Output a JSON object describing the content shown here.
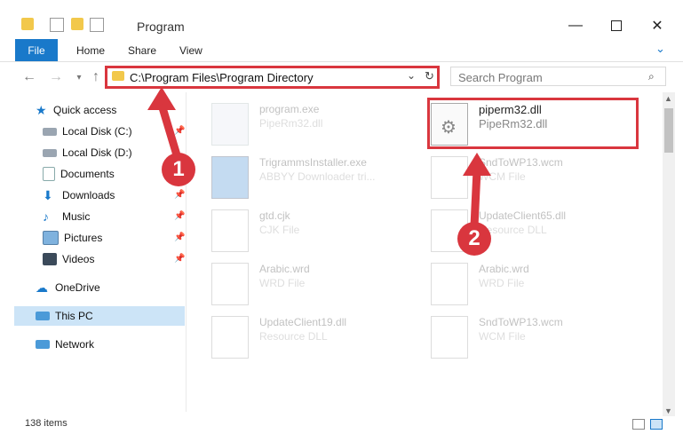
{
  "window": {
    "title": "Program",
    "min_icon": "minimize-icon",
    "max_icon": "maximize-icon",
    "close_icon": "close-icon"
  },
  "ribbon": {
    "tabs": [
      "File",
      "Home",
      "Share",
      "View"
    ]
  },
  "address": {
    "path": "C:\\Program Files\\Program Directory"
  },
  "search": {
    "placeholder": "Search Program"
  },
  "nav": {
    "items": [
      {
        "label": "Quick access"
      },
      {
        "label": "Local Disk (C:)"
      },
      {
        "label": "Local Disk (D:)"
      },
      {
        "label": "Documents"
      },
      {
        "label": "Downloads"
      },
      {
        "label": "Music"
      },
      {
        "label": "Pictures"
      },
      {
        "label": "Videos"
      },
      {
        "label": "OneDrive"
      },
      {
        "label": "This PC"
      },
      {
        "label": "Network"
      }
    ]
  },
  "files": [
    {
      "name": "program.exe",
      "type": "PipeRm32.dll"
    },
    {
      "name": "piperm32.dll",
      "type": "PipeRm32.dll"
    },
    {
      "name": "TrigrammsInstaller.exe",
      "type": "ABBYY Downloader tri..."
    },
    {
      "name": "SndToWP13.wcm",
      "type": "WCM File"
    },
    {
      "name": "gtd.cjk",
      "type": "CJK File"
    },
    {
      "name": "UpdateClient65.dll",
      "type": "Resource DLL"
    },
    {
      "name": "Arabic.wrd",
      "type": "WRD File"
    },
    {
      "name": "Arabic.wrd",
      "type": "WRD File"
    },
    {
      "name": "UpdateClient19.dll",
      "type": "Resource DLL"
    },
    {
      "name": "SndToWP13.wcm",
      "type": "WCM File"
    }
  ],
  "status": {
    "items": "138 items"
  },
  "annotations": {
    "step1": "1",
    "step2": "2"
  },
  "colors": {
    "accent": "#1979ca",
    "highlight": "#d9363e",
    "selection": "#cce4f7"
  }
}
